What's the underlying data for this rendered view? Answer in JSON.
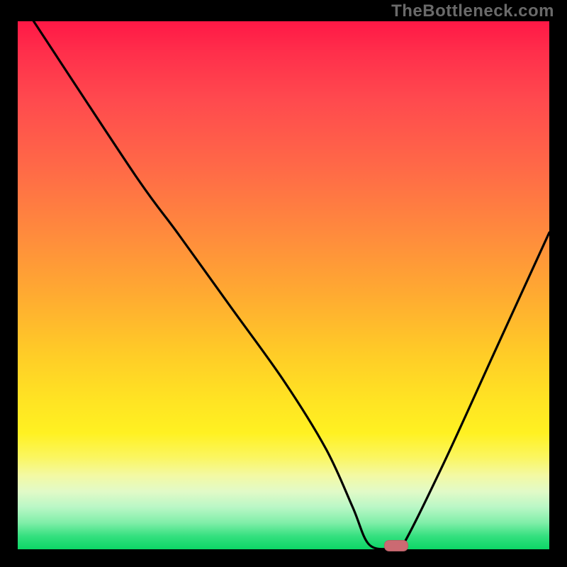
{
  "watermark": "TheBottleneck.com",
  "colors": {
    "frame": "#000000",
    "gradient_top": "#ff1846",
    "gradient_mid": "#ffcc27",
    "gradient_bottom": "#0cd666",
    "curve_stroke": "#000000",
    "marker_fill": "#cb6a72"
  },
  "chart_data": {
    "type": "line",
    "title": "",
    "xlabel": "",
    "ylabel": "",
    "xlim": [
      0,
      100
    ],
    "ylim": [
      0,
      100
    ],
    "series": [
      {
        "name": "bottleneck-curve",
        "x": [
          3,
          22,
          30,
          40,
          50,
          58,
          63,
          66,
          70,
          72,
          80,
          90,
          100
        ],
        "values": [
          100,
          71,
          60,
          46,
          32,
          19,
          8,
          1,
          0,
          0,
          16,
          38,
          60
        ]
      }
    ],
    "annotations": [
      {
        "name": "optimal-marker",
        "x": 71,
        "y": 0.8,
        "shape": "pill",
        "color": "#cb6a72"
      }
    ]
  }
}
